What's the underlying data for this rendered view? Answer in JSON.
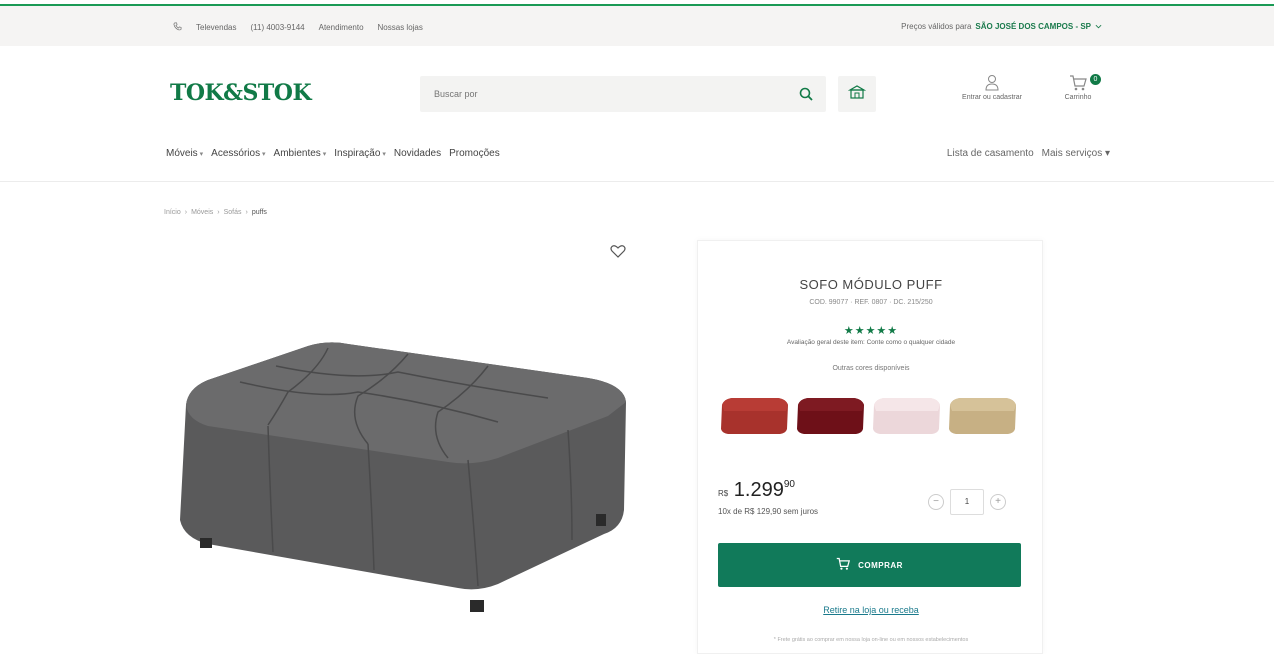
{
  "topbar": {
    "phone_label": "Televendas",
    "phone_number": "(11) 4003-9144",
    "links": [
      "Atendimento",
      "Nossas lojas"
    ],
    "location_prefix": "Preços válidos para",
    "location_value": "SÃO JOSÉ DOS CAMPOS - SP"
  },
  "header": {
    "logo": "TOK&STOK",
    "search_placeholder": "Buscar por",
    "account_label": "Entrar ou cadastrar",
    "cart_label": "Carrinho",
    "cart_count": "0"
  },
  "nav": {
    "items": [
      {
        "label": "Móveis",
        "dropdown": true
      },
      {
        "label": "Acessórios",
        "dropdown": true
      },
      {
        "label": "Ambientes",
        "dropdown": true
      },
      {
        "label": "Inspiração",
        "dropdown": true
      },
      {
        "label": "Novidades",
        "dropdown": false
      },
      {
        "label": "Promoções",
        "dropdown": false
      }
    ],
    "right": [
      "Lista de casamento",
      "Mais serviços ▾"
    ]
  },
  "breadcrumb": [
    "Início",
    "Móveis",
    "Sofás",
    "puffs"
  ],
  "product": {
    "title": "SOFO MÓDULO PUFF",
    "code": "COD. 99077 · REF. 0807 · DC. 215/250",
    "stars": "★★★★★",
    "rating_text": "Avaliação geral deste item: Conte como o qualquer cidade",
    "other_colors_label": "Outras cores disponíveis",
    "swatches": [
      {
        "name": "red",
        "color": "#a8322c"
      },
      {
        "name": "burgundy",
        "color": "#6e1018"
      },
      {
        "name": "pink",
        "color": "#f1dde0"
      },
      {
        "name": "beige",
        "color": "#cdb78a"
      }
    ],
    "main_color": "#5a5a5b",
    "price_currency": "R$",
    "price_int": "1.299",
    "price_cents": "90",
    "installments": "10x de R$ 129,90 sem juros",
    "quantity": "1",
    "buy_label": "COMPRAR",
    "pickup_label": "Retire na loja ou receba",
    "note": "* Frete grátis ao comprar em nossa loja on-line ou em nossos estabelecimentos"
  }
}
